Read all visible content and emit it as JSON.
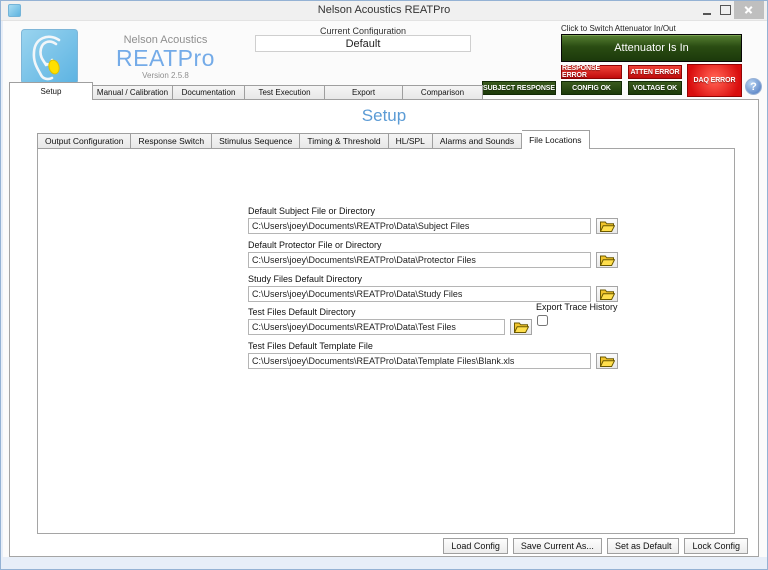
{
  "window": {
    "title": "Nelson Acoustics REATPro"
  },
  "header": {
    "brand": {
      "company": "Nelson Acoustics",
      "product": "REATPro",
      "version": "Version 2.5.8"
    },
    "config": {
      "label": "Current Configuration",
      "value": "Default"
    },
    "attenuator": {
      "caption": "Click to Switch Attenuator In/Out",
      "button_label": "Attenuator Is In"
    },
    "badges": {
      "response_error": "RESPONSE ERROR",
      "atten_error": "ATTEN ERROR",
      "daq_error": "DAQ ERROR",
      "subject_response": "SUBJECT RESPONSE",
      "config_ok": "CONFIG OK",
      "voltage_ok": "VOLTAGE OK"
    },
    "help_label": "?"
  },
  "main_tabs": [
    "Setup",
    "Manual / Calibration",
    "Documentation",
    "Test Execution",
    "Export",
    "Comparison"
  ],
  "active_main_tab": "Setup",
  "setup": {
    "heading": "Setup",
    "sub_tabs": [
      "Output Configuration",
      "Response Switch",
      "Stimulus Sequence",
      "Timing & Threshold",
      "HL/SPL",
      "Alarms and Sounds",
      "File Locations"
    ],
    "active_sub_tab": "File Locations",
    "fields": [
      {
        "label": "Default Subject File or Directory",
        "value": "C:\\Users\\joey\\Documents\\REATPro\\Data\\Subject Files"
      },
      {
        "label": "Default Protector File or Directory",
        "value": "C:\\Users\\joey\\Documents\\REATPro\\Data\\Protector Files"
      },
      {
        "label": "Study Files Default Directory",
        "value": "C:\\Users\\joey\\Documents\\REATPro\\Data\\Study Files"
      },
      {
        "label": "Test Files Default Directory",
        "value": "C:\\Users\\joey\\Documents\\REATPro\\Data\\Test Files"
      },
      {
        "label": "Test Files Default Template File",
        "value": "C:\\Users\\joey\\Documents\\REATPro\\Data\\Template Files\\Blank.xls"
      }
    ],
    "export_trace": {
      "label": "Export Trace History",
      "checked": false
    },
    "footer_buttons": {
      "load": "Load Config",
      "save_as": "Save Current As...",
      "set_default": "Set as Default",
      "lock": "Lock Config"
    }
  },
  "colors": {
    "accent_blue": "#74abe8",
    "logo_blue": "#7cc6e9",
    "status_green": "#1f4409",
    "error_red": "#d90e0e"
  }
}
